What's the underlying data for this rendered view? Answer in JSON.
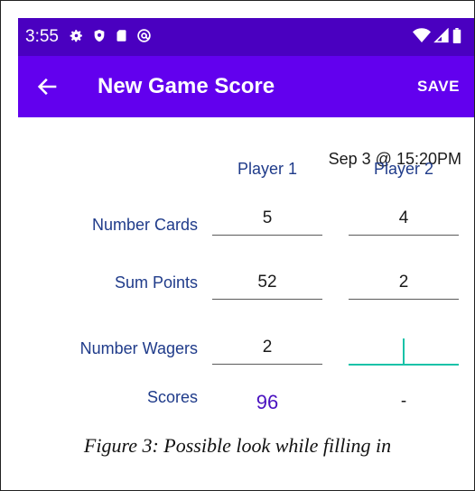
{
  "status_bar": {
    "time": "3:55",
    "left_icons": [
      "gear-icon",
      "shield-icon",
      "sd-card-icon",
      "at-sign-icon"
    ],
    "right_icons": [
      "wifi-icon",
      "signal-icon",
      "battery-icon"
    ]
  },
  "app_bar": {
    "back_icon": "arrow-left-icon",
    "title": "New Game Score",
    "save_label": "SAVE",
    "color": "#6200ee"
  },
  "score_form": {
    "date": "Sep 3 @ 15:20PM",
    "columns": [
      "Player 1",
      "Player 2"
    ],
    "rows": [
      {
        "label": "Number Cards",
        "values": [
          "5",
          "4"
        ]
      },
      {
        "label": "Sum Points",
        "values": [
          "52",
          "2"
        ]
      },
      {
        "label": "Number Wagers",
        "values": [
          "2",
          ""
        ]
      }
    ],
    "scores": {
      "label": "Scores",
      "player1": "96",
      "player2": "-"
    },
    "focus_color": "#18c2a8"
  },
  "caption": "Figure 3: Possible look while filling in"
}
